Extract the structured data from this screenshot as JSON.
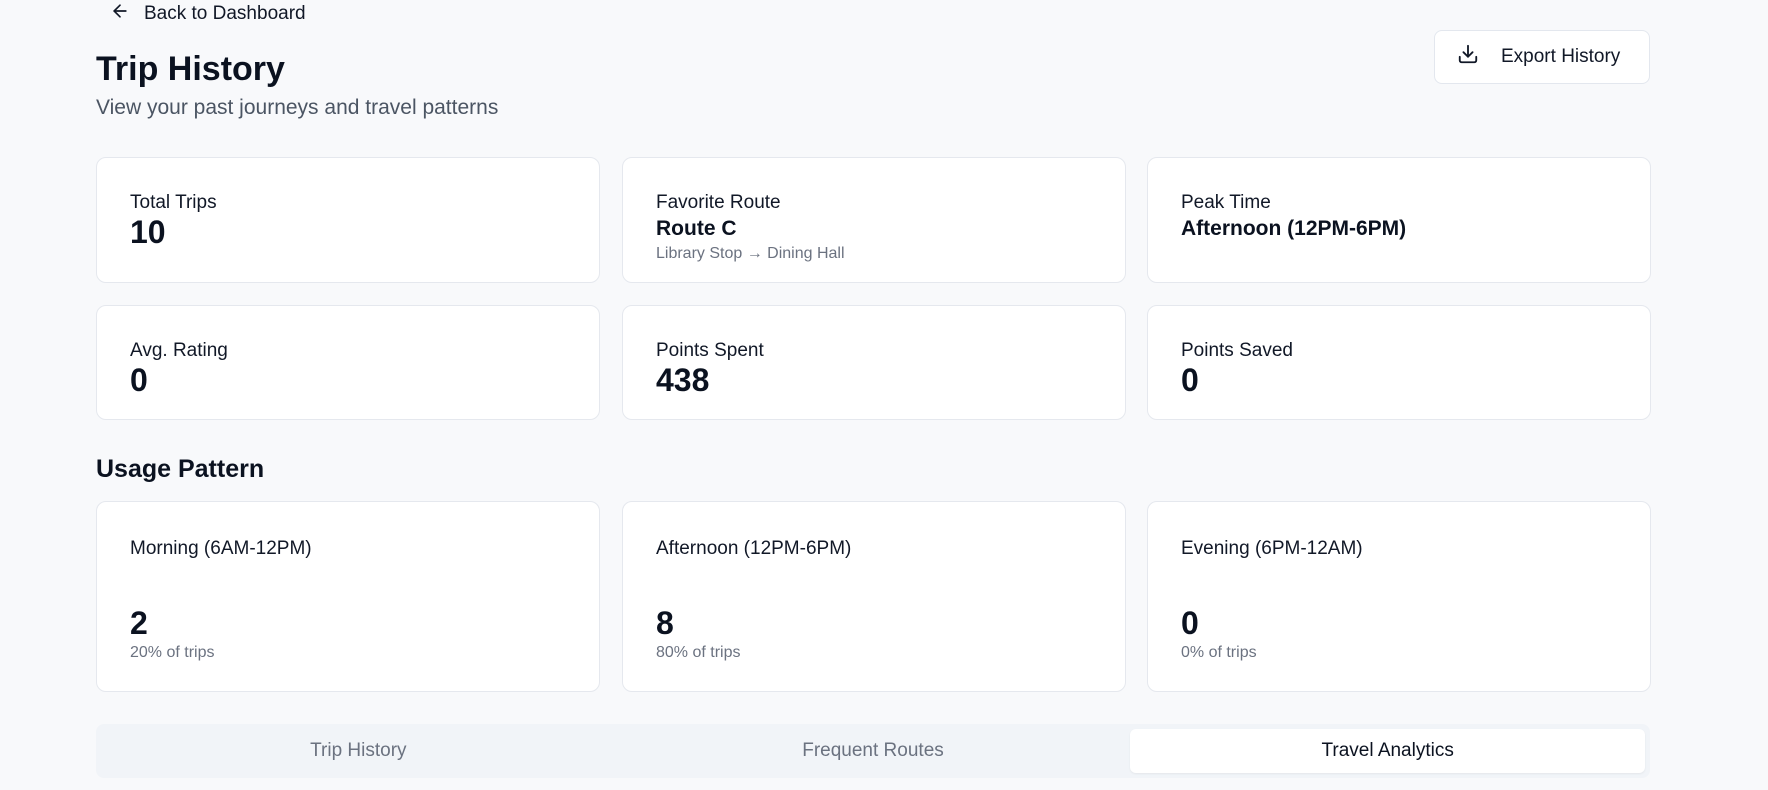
{
  "nav": {
    "back_label": "Back to Dashboard",
    "back_icon": "arrow-left-icon"
  },
  "header": {
    "title": "Trip History",
    "subtitle": "View your past journeys and travel patterns",
    "export_label": "Export History",
    "export_icon": "download-icon"
  },
  "stats": {
    "total_trips": {
      "label": "Total Trips",
      "value": "10"
    },
    "favorite_route": {
      "label": "Favorite Route",
      "value": "Route C",
      "detail": "Library Stop → Dining Hall"
    },
    "peak_time": {
      "label": "Peak Time",
      "value": "Afternoon (12PM-6PM)"
    },
    "avg_rating": {
      "label": "Avg. Rating",
      "value": "0"
    },
    "points_spent": {
      "label": "Points Spent",
      "value": "438"
    },
    "points_saved": {
      "label": "Points Saved",
      "value": "0"
    }
  },
  "usage": {
    "title": "Usage Pattern",
    "periods": [
      {
        "label": "Morning (6AM-12PM)",
        "value": "2",
        "share": "20% of trips"
      },
      {
        "label": "Afternoon (12PM-6PM)",
        "value": "8",
        "share": "80% of trips"
      },
      {
        "label": "Evening (6PM-12AM)",
        "value": "0",
        "share": "0% of trips"
      }
    ]
  },
  "tabs": {
    "items": [
      {
        "label": "Trip History"
      },
      {
        "label": "Frequent Routes"
      },
      {
        "label": "Travel Analytics"
      }
    ],
    "active": "Travel Analytics"
  },
  "colors": {
    "background": "#f8f9fb",
    "card": "#ffffff",
    "border": "#e5e8ee",
    "text": "#0b1220",
    "muted": "#6b7280"
  }
}
